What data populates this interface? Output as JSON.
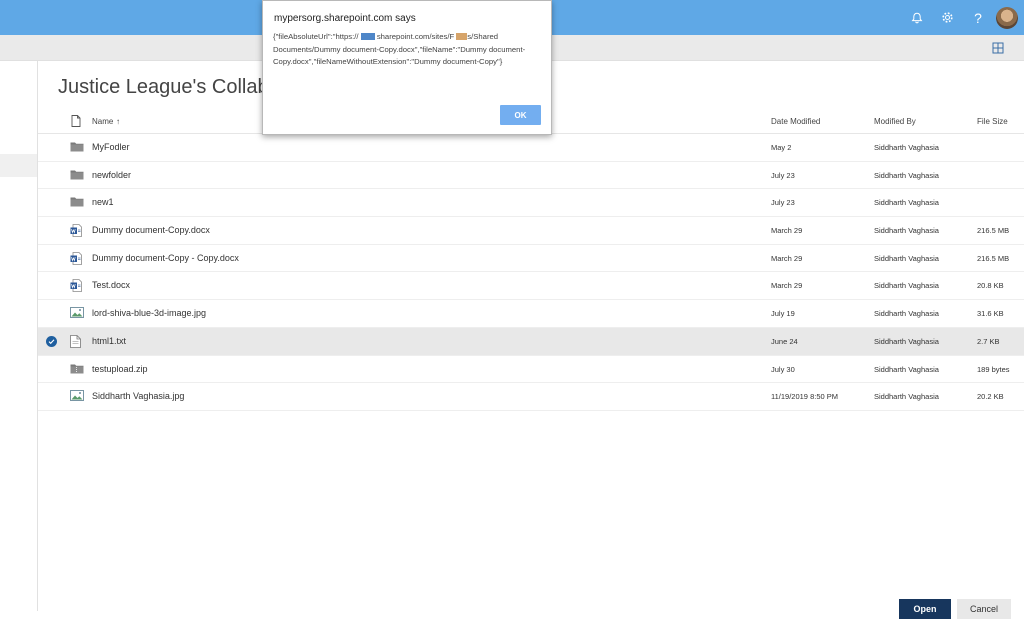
{
  "topbar": {
    "icons": [
      "bell-icon",
      "gear-icon",
      "help-icon"
    ],
    "help_glyph": "?",
    "color": "#5fa8e6"
  },
  "library": {
    "title": "Justice League's Collaborati"
  },
  "columns": {
    "name": "Name",
    "name_sort_glyph": "↑",
    "date": "Date Modified",
    "by": "Modified By",
    "size": "File Size"
  },
  "files": [
    {
      "name": "MyFodler",
      "type": "folder",
      "date": "May 2",
      "by": "Siddharth Vaghasia",
      "size": ""
    },
    {
      "name": "newfolder",
      "type": "folder",
      "date": "July 23",
      "by": "Siddharth Vaghasia",
      "size": ""
    },
    {
      "name": "new1",
      "type": "folder",
      "date": "July 23",
      "by": "Siddharth Vaghasia",
      "size": ""
    },
    {
      "name": "Dummy document-Copy.docx",
      "type": "word",
      "date": "March 29",
      "by": "Siddharth Vaghasia",
      "size": "216.5 MB"
    },
    {
      "name": "Dummy document-Copy - Copy.docx",
      "type": "word",
      "date": "March 29",
      "by": "Siddharth Vaghasia",
      "size": "216.5 MB"
    },
    {
      "name": "Test.docx",
      "type": "word",
      "date": "March 29",
      "by": "Siddharth Vaghasia",
      "size": "20.8 KB"
    },
    {
      "name": "lord-shiva-blue-3d-image.jpg",
      "type": "image",
      "date": "July 19",
      "by": "Siddharth Vaghasia",
      "size": "31.6 KB"
    },
    {
      "name": "html1.txt",
      "type": "text",
      "date": "June 24",
      "by": "Siddharth Vaghasia",
      "size": "2.7 KB",
      "selected": true
    },
    {
      "name": "testupload.zip",
      "type": "zip",
      "date": "July 30",
      "by": "Siddharth Vaghasia",
      "size": "189 bytes"
    },
    {
      "name": "Siddharth Vaghasia.jpg",
      "type": "image",
      "date": "11/19/2019 8:50 PM",
      "by": "Siddharth Vaghasia",
      "size": "20.2 KB"
    }
  ],
  "dialog": {
    "title": "mypersorg.sharepoint.com says",
    "msg_part1": "{\"fileAbsoluteUrl\":\"https://",
    "msg_part2": "sharepoint.com/sites/F",
    "msg_part3": "s/Shared Documents/Dummy document-Copy.docx\",\"fileName\":\"Dummy document-Copy.docx\",\"fileNameWithoutExtension\":\"Dummy document-Copy\"}",
    "ok_label": "OK"
  },
  "footer": {
    "open_label": "Open",
    "cancel_label": "Cancel"
  }
}
